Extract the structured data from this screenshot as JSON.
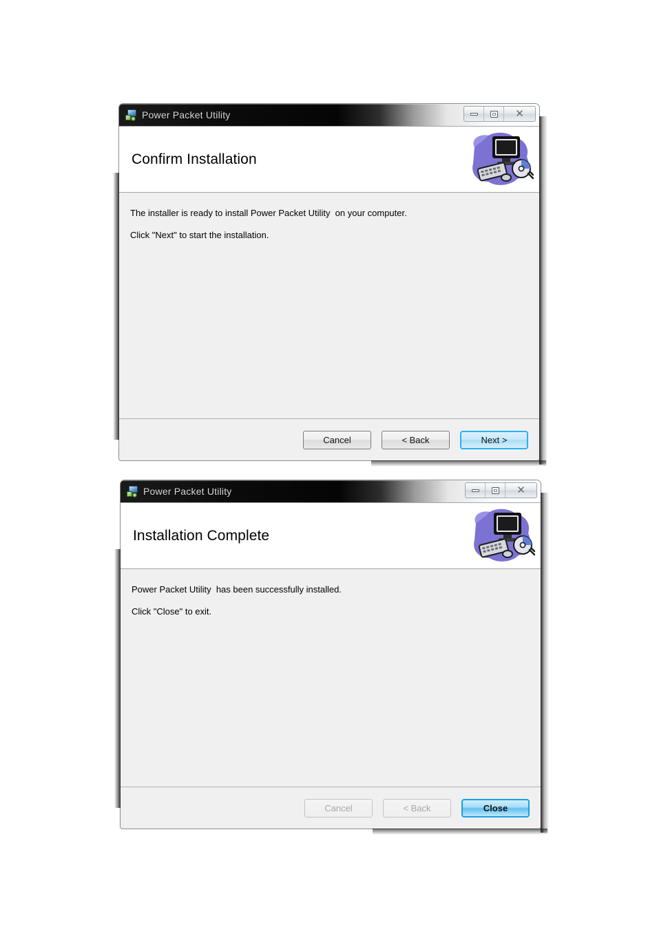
{
  "dialogs": [
    {
      "window_title": "Power Packet Utility",
      "heading": "Confirm Installation",
      "body_lines": [
        "The installer is ready to install Power Packet Utility  on your computer.",
        "Click \"Next\" to start the installation."
      ],
      "buttons": [
        {
          "label": "Cancel",
          "state": "enabled"
        },
        {
          "label": "< Back",
          "state": "enabled"
        },
        {
          "label": "Next >",
          "state": "default"
        }
      ],
      "window_controls": {
        "minimize": "minimize",
        "maximize": "restore",
        "close": "close"
      }
    },
    {
      "window_title": "Power Packet Utility",
      "heading": "Installation Complete",
      "body_lines": [
        "Power Packet Utility  has been successfully installed.",
        "Click \"Close\" to exit."
      ],
      "buttons": [
        {
          "label": "Cancel",
          "state": "disabled"
        },
        {
          "label": "< Back",
          "state": "disabled"
        },
        {
          "label": "Close",
          "state": "default-strong"
        }
      ],
      "window_controls": {
        "minimize": "minimize",
        "maximize": "restore",
        "close": "close"
      }
    }
  ],
  "icons": {
    "titlebar": "msi-installer-icon",
    "header_graphic": "computer-monitor-keyboard-cd-icon",
    "close_glyph": "✕"
  },
  "colors": {
    "accent_blue": "#2ab0ee",
    "content_background": "#f0f0f0",
    "header_background": "#ffffff",
    "graphic_blob": "#7b72d4",
    "page_background": "#ffffff"
  }
}
